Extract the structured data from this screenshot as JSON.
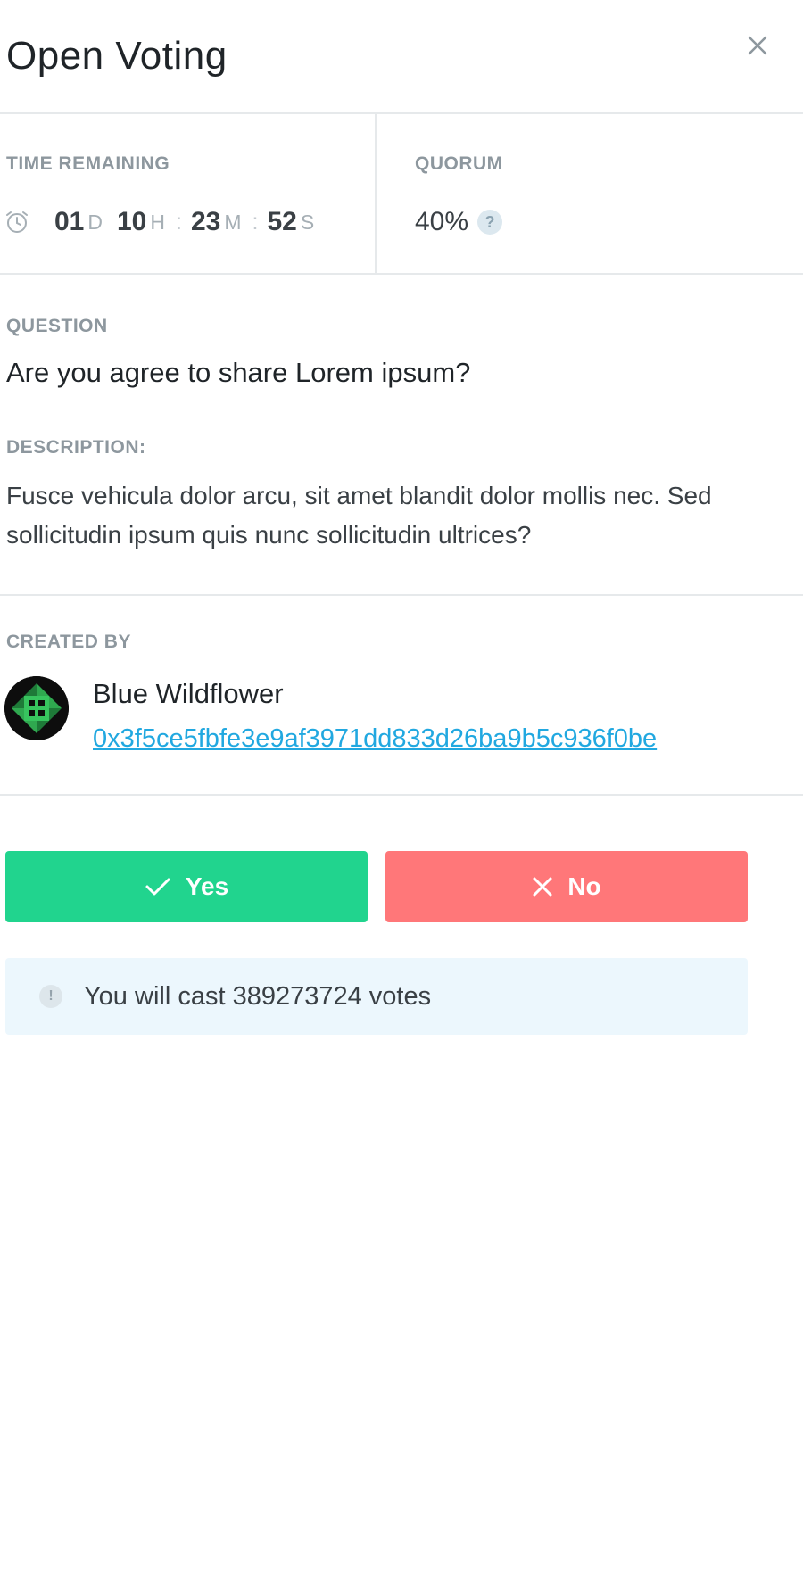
{
  "header": {
    "title": "Open Voting"
  },
  "time_remaining": {
    "label": "TIME REMAINING",
    "days": "01",
    "days_unit": "D",
    "hours": "10",
    "hours_unit": "H",
    "minutes": "23",
    "minutes_unit": "M",
    "seconds": "52",
    "seconds_unit": "S",
    "separator": ":"
  },
  "quorum": {
    "label": "QUORUM",
    "value": "40%",
    "help_glyph": "?"
  },
  "question": {
    "label": "QUESTION",
    "text": "Are you agree to share Lorem ipsum?"
  },
  "description": {
    "label": "DESCRIPTION:",
    "text": "Fusce vehicula dolor arcu, sit amet blandit dolor mollis nec. Sed sollicitudin ipsum quis nunc sollicitudin ultrices?"
  },
  "creator": {
    "label": "CREATED BY",
    "name": "Blue Wildflower",
    "address": "0x3f5ce5fbfe3e9af3971dd833d26ba9b5c936f0be"
  },
  "actions": {
    "yes_label": "Yes",
    "no_label": "No"
  },
  "notice": {
    "glyph": "!",
    "text": "You will cast 389273724 votes"
  },
  "colors": {
    "yes": "#21d48e",
    "no": "#ff7779",
    "link": "#21a8e0",
    "notice_bg": "#ecf7fd"
  }
}
